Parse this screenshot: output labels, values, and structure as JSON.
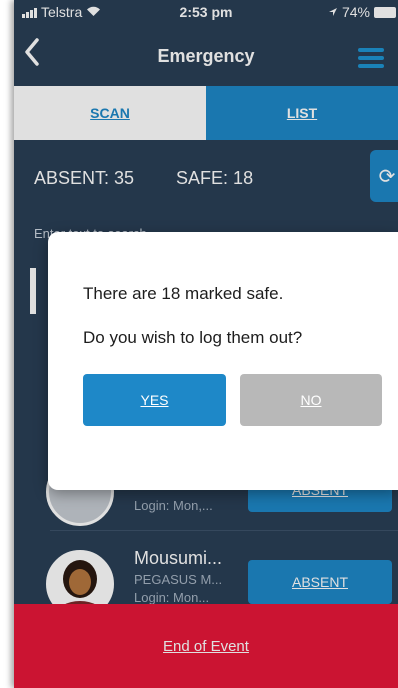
{
  "status_bar": {
    "carrier": "Telstra",
    "time": "2:53 pm",
    "battery": "74%"
  },
  "nav": {
    "title": "Emergency",
    "back_icon": "chevron-left-icon",
    "menu_icon": "hamburger-menu-icon"
  },
  "tabs": {
    "scan": "SCAN",
    "list": "LIST"
  },
  "counts": {
    "absent": "ABSENT: 35",
    "safe": "SAFE: 18"
  },
  "filter": {
    "text": "Enter text to search"
  },
  "people": [
    {
      "name": "",
      "org": "",
      "login": "Login: Mon,...",
      "action": "ABSENT"
    },
    {
      "name": "Mousumi...",
      "org": "PEGASUS M...",
      "login": "Login: Mon...",
      "action": "ABSENT"
    }
  ],
  "dialog": {
    "message1": "There are 18 marked safe.",
    "message2": "Do you wish to log them out?",
    "yes": "YES",
    "no": "NO"
  },
  "footer": {
    "label": "End of Event"
  },
  "colors": {
    "accent": "#1e88c8",
    "background": "#2a3f56",
    "danger": "#e8173a"
  }
}
